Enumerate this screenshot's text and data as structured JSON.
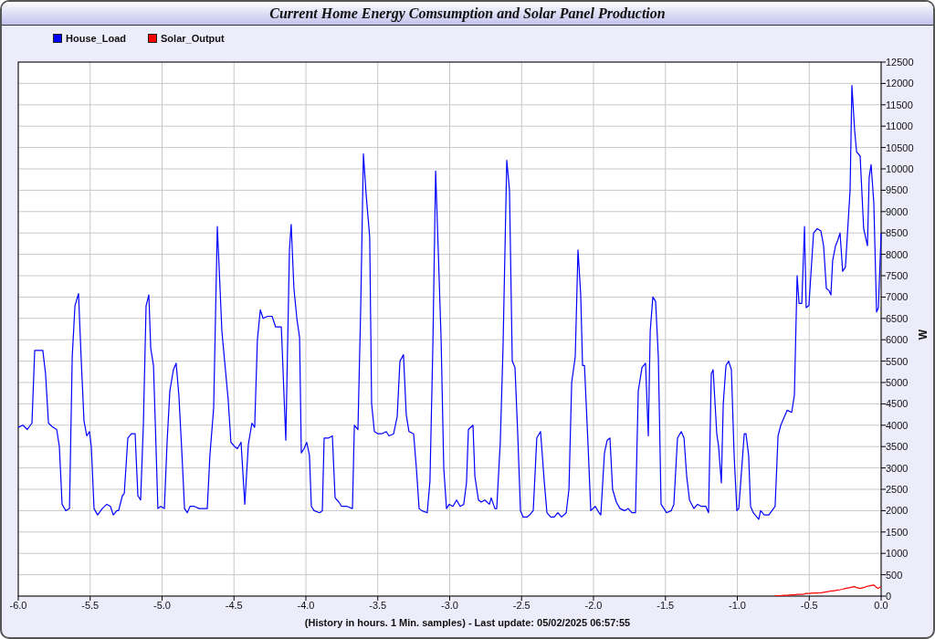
{
  "window": {
    "title": "Current Home Energy Comsumption and Solar Panel Production"
  },
  "chart": {
    "chart_data": {
      "type": "line",
      "grid": true,
      "xlabel": "(History in hours. 1 Min. samples) - Last update: 05/02/2025 06:57:55",
      "ylabel": "W",
      "xlim": [
        -6,
        0
      ],
      "ylim": [
        0,
        12500
      ],
      "xticks": [
        {
          "value": -6,
          "label": "-6.0"
        },
        {
          "value": -5.5,
          "label": "-5.5"
        },
        {
          "value": -5,
          "label": "-5.0"
        },
        {
          "value": -4.5,
          "label": "-4.5"
        },
        {
          "value": -4,
          "label": "-4.0"
        },
        {
          "value": -3.5,
          "label": "-3.5"
        },
        {
          "value": -3,
          "label": "-3.0"
        },
        {
          "value": -2.5,
          "label": "-2.5"
        },
        {
          "value": -2,
          "label": "-2.0"
        },
        {
          "value": -1.5,
          "label": "-1.5"
        },
        {
          "value": -1,
          "label": "-1.0"
        },
        {
          "value": -0.5,
          "label": "-0.5"
        },
        {
          "value": 0,
          "label": "0.0"
        }
      ],
      "yticks": [
        0,
        500,
        1000,
        1500,
        2000,
        2500,
        3000,
        3500,
        4000,
        4500,
        5000,
        5500,
        6000,
        6500,
        7000,
        7500,
        8000,
        8500,
        9000,
        9500,
        10000,
        10500,
        11000,
        11500,
        12000,
        12500
      ],
      "x": [
        -6.0,
        -5.968,
        -5.937,
        -5.905,
        -5.886,
        -5.829,
        -5.81,
        -5.79,
        -5.759,
        -5.733,
        -5.714,
        -5.695,
        -5.67,
        -5.644,
        -5.625,
        -5.606,
        -5.581,
        -5.562,
        -5.543,
        -5.524,
        -5.505,
        -5.492,
        -5.473,
        -5.448,
        -5.416,
        -5.384,
        -5.359,
        -5.34,
        -5.314,
        -5.302,
        -5.276,
        -5.263,
        -5.238,
        -5.213,
        -5.187,
        -5.168,
        -5.149,
        -5.13,
        -5.111,
        -5.092,
        -5.079,
        -5.06,
        -5.041,
        -5.029,
        -5.01,
        -4.984,
        -4.965,
        -4.946,
        -4.921,
        -4.902,
        -4.883,
        -4.863,
        -4.844,
        -4.825,
        -4.806,
        -4.775,
        -4.743,
        -4.686,
        -4.667,
        -4.641,
        -4.616,
        -4.597,
        -4.584,
        -4.565,
        -4.54,
        -4.521,
        -4.495,
        -4.476,
        -4.451,
        -4.425,
        -4.4,
        -4.375,
        -4.356,
        -4.337,
        -4.317,
        -4.298,
        -4.267,
        -4.235,
        -4.21,
        -4.171,
        -4.14,
        -4.114,
        -4.102,
        -4.083,
        -4.063,
        -4.044,
        -4.032,
        -4.013,
        -3.994,
        -3.975,
        -3.962,
        -3.943,
        -3.905,
        -3.886,
        -3.873,
        -3.841,
        -3.816,
        -3.797,
        -3.771,
        -3.752,
        -3.714,
        -3.676,
        -3.663,
        -3.638,
        -3.619,
        -3.6,
        -3.581,
        -3.556,
        -3.543,
        -3.524,
        -3.498,
        -3.473,
        -3.441,
        -3.422,
        -3.39,
        -3.365,
        -3.346,
        -3.321,
        -3.302,
        -3.283,
        -3.251,
        -3.232,
        -3.213,
        -3.194,
        -3.156,
        -3.137,
        -3.117,
        -3.098,
        -3.079,
        -3.06,
        -3.041,
        -3.022,
        -3.003,
        -2.978,
        -2.952,
        -2.927,
        -2.902,
        -2.883,
        -2.87,
        -2.838,
        -2.825,
        -2.8,
        -2.781,
        -2.756,
        -2.724,
        -2.711,
        -2.686,
        -2.673,
        -2.648,
        -2.629,
        -2.603,
        -2.584,
        -2.565,
        -2.546,
        -2.527,
        -2.508,
        -2.489,
        -2.463,
        -2.444,
        -2.419,
        -2.394,
        -2.368,
        -2.343,
        -2.324,
        -2.298,
        -2.273,
        -2.248,
        -2.222,
        -2.19,
        -2.171,
        -2.152,
        -2.127,
        -2.108,
        -2.089,
        -2.076,
        -2.063,
        -2.038,
        -2.019,
        -1.987,
        -1.962,
        -1.949,
        -1.924,
        -1.905,
        -1.886,
        -1.867,
        -1.841,
        -1.816,
        -1.784,
        -1.759,
        -1.733,
        -1.708,
        -1.689,
        -1.663,
        -1.638,
        -1.619,
        -1.606,
        -1.587,
        -1.568,
        -1.549,
        -1.53,
        -1.492,
        -1.46,
        -1.441,
        -1.416,
        -1.39,
        -1.371,
        -1.352,
        -1.333,
        -1.302,
        -1.276,
        -1.251,
        -1.219,
        -1.2,
        -1.181,
        -1.168,
        -1.143,
        -1.13,
        -1.111,
        -1.098,
        -1.079,
        -1.06,
        -1.041,
        -1.022,
        -1.003,
        -0.99,
        -0.952,
        -0.94,
        -0.921,
        -0.908,
        -0.889,
        -0.851,
        -0.838,
        -0.813,
        -0.781,
        -0.737,
        -0.717,
        -0.698,
        -0.679,
        -0.654,
        -0.622,
        -0.603,
        -0.584,
        -0.571,
        -0.552,
        -0.533,
        -0.521,
        -0.502,
        -0.47,
        -0.444,
        -0.419,
        -0.4,
        -0.381,
        -0.362,
        -0.349,
        -0.337,
        -0.317,
        -0.305,
        -0.286,
        -0.267,
        -0.248,
        -0.216,
        -0.203,
        -0.184,
        -0.171,
        -0.146,
        -0.121,
        -0.095,
        -0.083,
        -0.07,
        -0.051,
        -0.032,
        -0.019,
        0.0
      ],
      "series": [
        {
          "name": "House_Load",
          "color": "#0000ff",
          "values": [
            3950,
            4000,
            3900,
            4050,
            5750,
            5750,
            5200,
            4050,
            3950,
            3900,
            3500,
            2150,
            2000,
            2050,
            5600,
            6800,
            7080,
            5500,
            4100,
            3750,
            3850,
            3500,
            2050,
            1900,
            2050,
            2150,
            2100,
            1900,
            2000,
            2000,
            2350,
            2400,
            3700,
            3800,
            3800,
            2350,
            2250,
            4000,
            6800,
            7050,
            5800,
            5400,
            3400,
            2050,
            2100,
            2050,
            3600,
            4800,
            5300,
            5450,
            4700,
            3400,
            2050,
            1950,
            2100,
            2100,
            2050,
            2050,
            3300,
            4400,
            8650,
            7200,
            6200,
            5500,
            4600,
            3600,
            3500,
            3450,
            3600,
            2150,
            3550,
            4050,
            3950,
            6000,
            6700,
            6500,
            6550,
            6550,
            6300,
            6300,
            3650,
            8100,
            8700,
            7200,
            6500,
            6050,
            3350,
            3450,
            3600,
            3300,
            2100,
            2000,
            1950,
            2000,
            3700,
            3700,
            3750,
            2300,
            2200,
            2100,
            2100,
            2050,
            4000,
            3900,
            6700,
            10350,
            9400,
            8400,
            4500,
            3850,
            3800,
            3800,
            3850,
            3750,
            3800,
            4200,
            5500,
            5650,
            4250,
            3850,
            3800,
            3000,
            2050,
            2000,
            1950,
            2700,
            5900,
            9950,
            8000,
            6000,
            3000,
            2050,
            2150,
            2100,
            2250,
            2100,
            2150,
            2650,
            3900,
            4000,
            2800,
            2250,
            2200,
            2250,
            2150,
            2300,
            2050,
            2050,
            3600,
            5800,
            10200,
            9500,
            5500,
            5350,
            3800,
            2000,
            1850,
            1850,
            1900,
            2000,
            3700,
            3850,
            2700,
            1950,
            1850,
            1850,
            1950,
            1850,
            1950,
            2500,
            5000,
            5600,
            8100,
            7050,
            5400,
            5400,
            3550,
            2000,
            2100,
            1950,
            1900,
            3350,
            3650,
            3700,
            2500,
            2200,
            2050,
            2000,
            2050,
            1950,
            1950,
            4800,
            5350,
            5450,
            3750,
            6200,
            7000,
            6900,
            5600,
            2150,
            1950,
            2000,
            2150,
            3700,
            3850,
            3700,
            2800,
            2250,
            2050,
            2150,
            2100,
            2100,
            1950,
            5200,
            5300,
            3800,
            3500,
            2650,
            4500,
            5400,
            5500,
            5300,
            3300,
            2000,
            2050,
            3800,
            3800,
            3300,
            2100,
            1950,
            1800,
            2000,
            1900,
            1900,
            2100,
            3750,
            4000,
            4150,
            4350,
            4300,
            4700,
            7500,
            6850,
            6850,
            8650,
            6750,
            6800,
            8500,
            8600,
            8550,
            8200,
            7200,
            7150,
            7050,
            7850,
            8200,
            8300,
            8500,
            7600,
            7700,
            9500,
            11950,
            10900,
            10400,
            10300,
            8600,
            8200,
            9800,
            10100,
            9200,
            6650,
            6750,
            8500
          ]
        },
        {
          "name": "Solar_Output",
          "color": "#ff0000",
          "values": [
            null,
            null,
            null,
            null,
            null,
            null,
            null,
            null,
            null,
            null,
            null,
            null,
            null,
            null,
            null,
            null,
            null,
            null,
            null,
            null,
            null,
            null,
            null,
            null,
            null,
            null,
            null,
            null,
            null,
            null,
            null,
            null,
            null,
            null,
            null,
            null,
            null,
            null,
            null,
            null,
            null,
            null,
            null,
            null,
            null,
            null,
            null,
            null,
            null,
            null,
            null,
            null,
            null,
            null,
            null,
            null,
            null,
            null,
            null,
            null,
            null,
            null,
            null,
            null,
            null,
            null,
            null,
            null,
            null,
            null,
            null,
            null,
            null,
            null,
            null,
            null,
            null,
            null,
            null,
            null,
            null,
            null,
            null,
            null,
            null,
            null,
            null,
            null,
            null,
            null,
            null,
            null,
            null,
            null,
            null,
            null,
            null,
            null,
            null,
            null,
            null,
            null,
            null,
            null,
            null,
            null,
            null,
            null,
            null,
            null,
            null,
            null,
            null,
            null,
            null,
            null,
            null,
            null,
            null,
            null,
            null,
            null,
            null,
            null,
            null,
            null,
            null,
            null,
            null,
            null,
            null,
            null,
            null,
            null,
            null,
            null,
            null,
            null,
            null,
            null,
            null,
            null,
            null,
            null,
            null,
            null,
            null,
            null,
            null,
            null,
            null,
            null,
            null,
            null,
            null,
            null,
            null,
            null,
            null,
            null,
            null,
            null,
            null,
            null,
            null,
            null,
            null,
            null,
            null,
            null,
            null,
            null,
            null,
            null,
            null,
            null,
            null,
            null,
            null,
            null,
            null,
            null,
            null,
            null,
            null,
            null,
            null,
            null,
            null,
            null,
            null,
            null,
            null,
            null,
            null,
            null,
            null,
            null,
            null,
            null,
            null,
            null,
            null,
            null,
            null,
            null,
            null,
            null,
            null,
            null,
            null,
            null,
            null,
            null,
            null,
            null,
            null,
            null,
            null,
            null,
            null,
            null,
            null,
            null,
            null,
            null,
            null,
            null,
            null,
            null,
            null,
            null,
            null,
            null,
            10,
            10,
            10,
            20,
            20,
            30,
            30,
            40,
            40,
            40,
            50,
            60,
            60,
            70,
            70,
            80,
            90,
            100,
            110,
            120,
            120,
            130,
            140,
            150,
            160,
            180,
            200,
            210,
            220,
            200,
            180,
            200,
            230,
            240,
            250,
            260,
            200,
            180,
            230
          ]
        }
      ]
    }
  }
}
